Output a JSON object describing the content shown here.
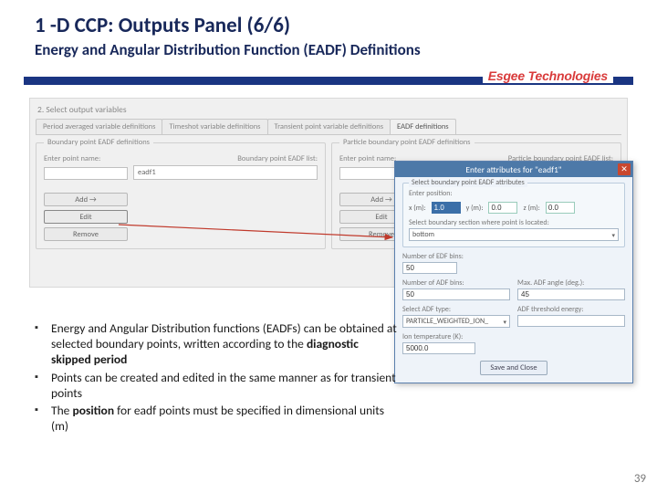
{
  "title": "1 -D CCP: Outputs Panel (6/6)",
  "subtitle": "Energy and Angular Distribution Function (EADF) Definitions",
  "brand": "Esgee Technologies",
  "page_number": "39",
  "step_label": "2. Select output variables",
  "tabs": [
    "Period averaged variable definitions",
    "Timeshot variable definitions",
    "Transient point variable definitions",
    "EADF definitions"
  ],
  "active_tab": 3,
  "group_left": {
    "legend": "Boundary point EADF definitions",
    "enter_label": "Enter point name:",
    "list_label": "Boundary point EADF list:",
    "list_items": [
      "eadf1"
    ],
    "add_btn": "Add →",
    "edit_btn": "Edit",
    "remove_btn": "Remove"
  },
  "group_right": {
    "legend": "Particle boundary point EADF definitions",
    "enter_label": "Enter point name:",
    "list_label": "Particle boundary point EADF list:",
    "add_btn": "Add →",
    "edit_btn": "Edit",
    "remove_btn": "Remove"
  },
  "dialog": {
    "title": "Enter attributes for \"eadf1\"",
    "group_legend": "Select boundary point EADF attributes",
    "enter_pos": "Enter position:",
    "x_label": "x (m):",
    "x_value": "1.0",
    "y_label": "y (m):",
    "y_value": "0.0",
    "z_label": "z (m):",
    "z_value": "0.0",
    "section_label": "Select boundary section where point is located:",
    "section_value": "bottom",
    "edf_bins_label": "Number of EDF bins:",
    "edf_bins_value": "50",
    "adf_bins_label": "Number of ADF bins:",
    "adf_bins_value": "50",
    "max_angle_label": "Max. ADF angle (deg.):",
    "max_angle_value": "45",
    "adf_type_label": "Select ADF type:",
    "adf_type_value": "PARTICLE_WEIGHTED_ION_",
    "adf_thresh_label": "ADF threshold energy:",
    "adf_thresh_value": "",
    "ion_temp_label": "Ion temperature (K):",
    "ion_temp_value": "5000.0",
    "save_btn": "Save and Close"
  },
  "bullets": {
    "b1a": "Energy and Angular Distribution functions (EADFs) can be obtained at selected boundary points, written according to the ",
    "b1b": "diagnostic skipped period",
    "b2": "Points can be created and edited in the same manner as for transient points",
    "b3a": "The ",
    "b3b": "position",
    "b3c": " for eadf points must be specified in dimensional units (m)"
  }
}
